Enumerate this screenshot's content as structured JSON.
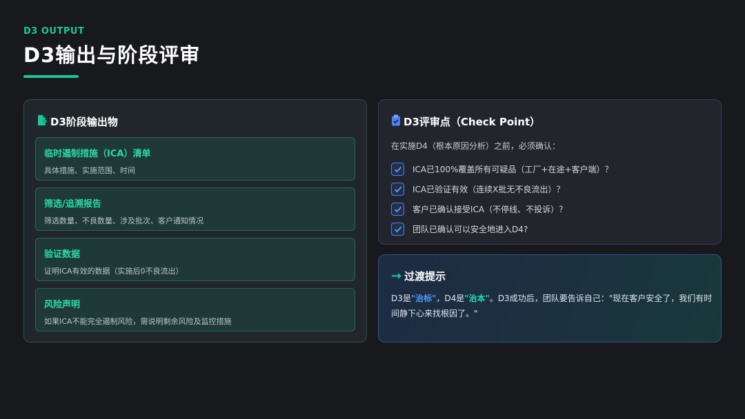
{
  "header": {
    "eyebrow": "D3 OUTPUT",
    "title": "D3输出与阶段评审"
  },
  "left_panel": {
    "heading": "D3阶段输出物",
    "icon": "file-export-icon",
    "items": [
      {
        "title": "临时遏制措施（ICA）清单",
        "desc": "具体措施、实施范围、时间"
      },
      {
        "title": "筛选/追溯报告",
        "desc": "筛选数量、不良数量、涉及批次、客户通知情况"
      },
      {
        "title": "验证数据",
        "desc": "证明ICA有效的数据（实施后0不良流出）"
      },
      {
        "title": "风险声明",
        "desc": "如果ICA不能完全遏制风险，需说明剩余风险及监控措施"
      }
    ]
  },
  "checkpoint": {
    "heading": "D3评审点（Check Point）",
    "icon": "clipboard-check-icon",
    "intro": "在实施D4（根本原因分析）之前，必须确认：",
    "items": [
      "ICA已100%覆盖所有可疑品（工厂+在途+客户端）？",
      "ICA已验证有效（连续X批无不良流出）？",
      "客户已确认接受ICA（不停线、不投诉）？",
      "团队已确认可以安全地进入D4?"
    ]
  },
  "tip": {
    "arrow": "→",
    "heading": "过渡提示",
    "segments": {
      "p1": "D3是",
      "h1": "\"治标\"",
      "p2": "，D4是",
      "h2": "\"治本\"",
      "p3": "。D3成功后，团队要告诉自己：\"现在客户安全了，我们有时间静下心来找根因了。\""
    }
  },
  "colors": {
    "accent_green": "#19c89a",
    "accent_blue": "#4b82f2",
    "background": "#18191d"
  }
}
